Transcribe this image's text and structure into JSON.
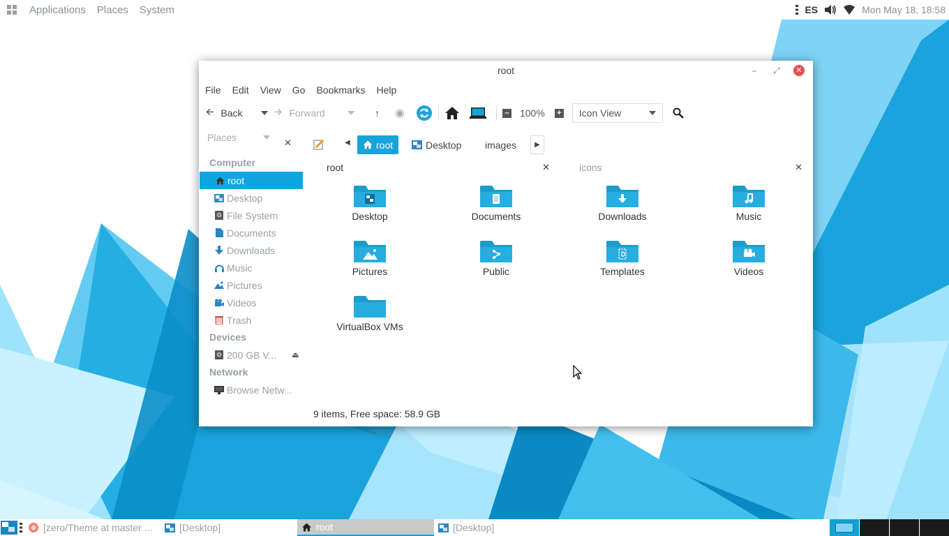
{
  "top_panel": {
    "menus": [
      "Applications",
      "Places",
      "System"
    ],
    "keyboard_layout": "ES",
    "clock": "Mon May 18, 18:58"
  },
  "window": {
    "title": "root",
    "menubar": [
      "File",
      "Edit",
      "View",
      "Go",
      "Bookmarks",
      "Help"
    ],
    "toolbar": {
      "back_label": "Back",
      "forward_label": "Forward",
      "zoom_level": "100%",
      "view_mode": "Icon View"
    },
    "location": {
      "places_label": "Places",
      "breadcrumbs": [
        "root",
        "Desktop",
        "images"
      ]
    },
    "sidebar": {
      "computer_heading": "Computer",
      "computer_items": [
        "root",
        "Desktop",
        "File System",
        "Documents",
        "Downloads",
        "Music",
        "Pictures",
        "Videos",
        "Trash"
      ],
      "devices_heading": "Devices",
      "devices_items": [
        "200 GB V..."
      ],
      "network_heading": "Network",
      "network_items": [
        "Browse Netw..."
      ]
    },
    "left_pane": {
      "header": "root",
      "items": [
        "Desktop",
        "Documents",
        "Downloads",
        "Music",
        "Pictures",
        "Public",
        "Templates",
        "Videos",
        "VirtualBox VMs"
      ]
    },
    "right_pane": {
      "header": "icons"
    },
    "status": "9 items, Free space: 58.9 GB"
  },
  "taskbar": {
    "tasks": [
      "[zero/Theme at master ...",
      "[Desktop]",
      "root",
      "[Desktop]"
    ]
  },
  "colors": {
    "accent": "#0fa6e0",
    "folder": "#1a9dc9",
    "close_button": "#e74c4c"
  }
}
